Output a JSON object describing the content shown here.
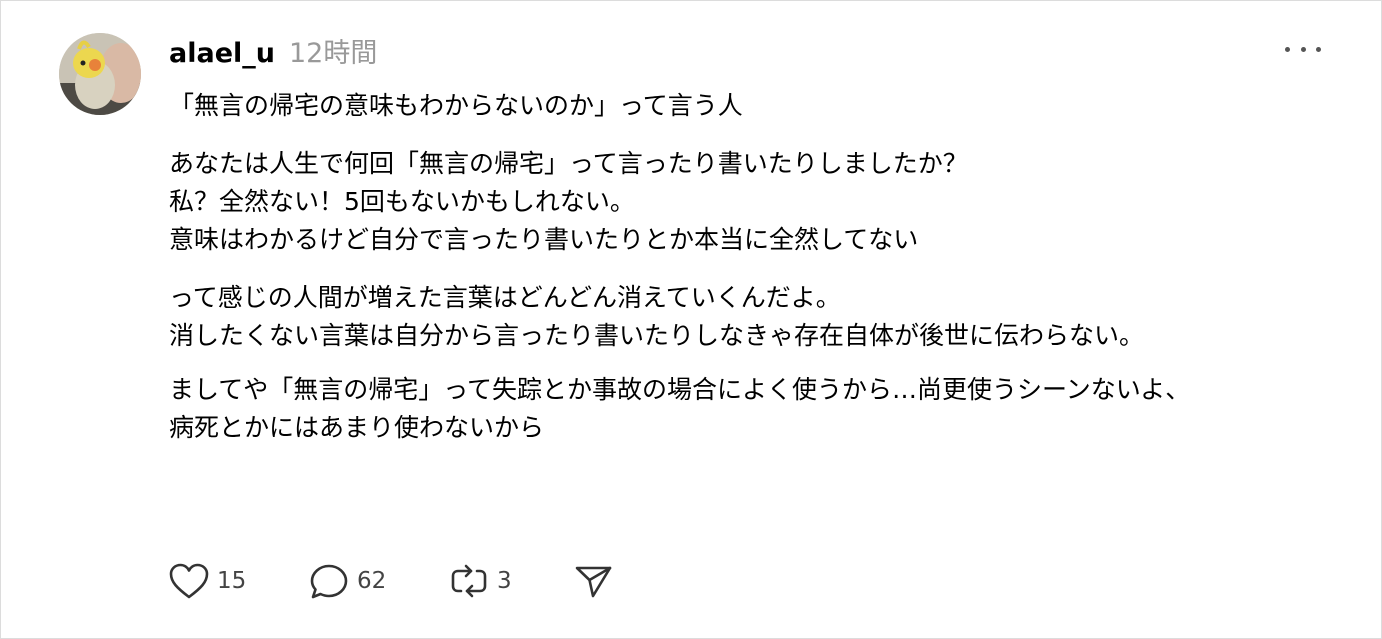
{
  "post": {
    "username": "alael_u",
    "timestamp": "12時間",
    "lines": [
      "「無言の帰宅の意味もわからないのか」って言う人",
      "あなたは人生で何回「無言の帰宅」って言ったり書いたりしましたか？",
      "私？全然ない！5回もないかもしれない。",
      "意味はわかるけど自分で言ったり書いたりとか本当に全然してない",
      "って感じの人間が増えた言葉はどんどん消えていくんだよ。",
      "消したくない言葉は自分から言ったり書いたりしなきゃ存在自体が後世に伝わらない。",
      "ましてや「無言の帰宅」って失踪とか事故の場合によく使うから…尚更使うシーンないよ、",
      "病死とかにはあまり使わないから"
    ]
  },
  "actions": {
    "like_count": "15",
    "reply_count": "62",
    "repost_count": "3"
  },
  "icons": {
    "more": "more-horizontal-icon",
    "like": "heart-icon",
    "reply": "comment-bubble-icon",
    "repost": "repost-icon",
    "share": "send-icon"
  },
  "colors": {
    "text": "#000000",
    "muted": "#999999",
    "icon": "#333333",
    "border": "#dcdcdc"
  }
}
